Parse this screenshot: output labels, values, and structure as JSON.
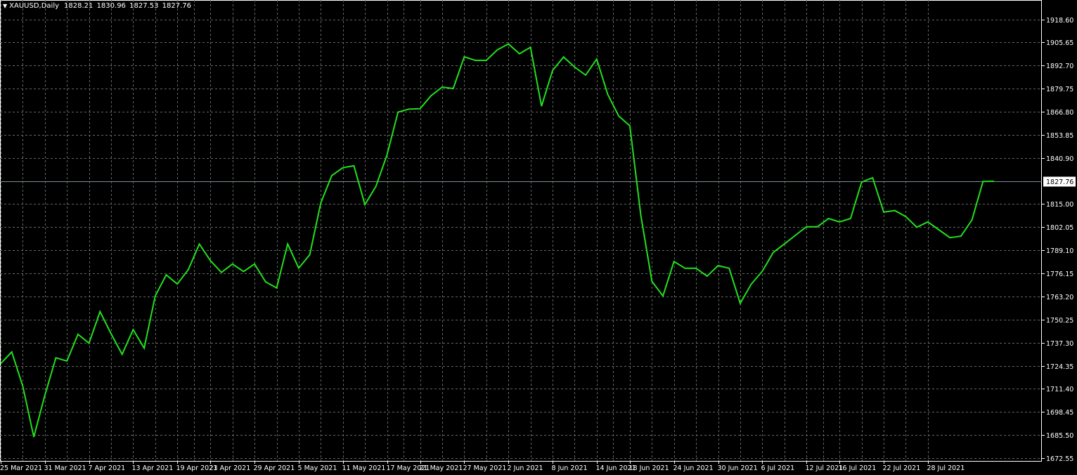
{
  "header": {
    "symbol": "XAUUSD,Daily",
    "open": "1828.21",
    "high": "1830.96",
    "low": "1827.53",
    "close": "1827.76",
    "menu_icon": "triangle-down-icon"
  },
  "colors": {
    "background": "#000000",
    "grid": "#5f6a5f",
    "line": "#22e01e",
    "axis_text": "#ffffff",
    "price_line": "#7f8c9e",
    "price_label_bg": "#ffffff",
    "price_label_text": "#000000"
  },
  "chart_data": {
    "type": "line",
    "symbol": "XAUUSD",
    "timeframe": "Daily",
    "current_price": 1827.76,
    "current_price_label": "1827.76",
    "ylim": [
      1672.55,
      1925.0
    ],
    "grid": true,
    "y_ticks": [
      "1918.60",
      "1905.65",
      "1892.70",
      "1879.75",
      "1866.80",
      "1853.85",
      "1840.90",
      "1827.76",
      "1815.00",
      "1802.05",
      "1789.10",
      "1776.15",
      "1763.20",
      "1750.25",
      "1737.30",
      "1724.35",
      "1711.40",
      "1698.45",
      "1685.50",
      "1672.55"
    ],
    "x_tick_labels": [
      "25 Mar 2021",
      "31 Mar 2021",
      "7 Apr 2021",
      "13 Apr 2021",
      "19 Apr 2021",
      "23 Apr 2021",
      "29 Apr 2021",
      "5 May 2021",
      "11 May 2021",
      "17 May 2021",
      "21 May 2021",
      "27 May 2021",
      "2 Jun 2021",
      "8 Jun 2021",
      "14 Jun 2021",
      "18 Jun 2021",
      "24 Jun 2021",
      "30 Jun 2021",
      "6 Jul 2021",
      "12 Jul 2021",
      "16 Jul 2021",
      "22 Jul 2021",
      "28 Jul 2021"
    ],
    "x_tick_index": [
      0,
      4,
      8,
      12,
      16,
      19,
      23,
      27,
      31,
      35,
      38,
      42,
      46,
      50,
      54,
      57,
      61,
      65,
      69,
      73,
      76,
      80,
      84
    ],
    "series": [
      {
        "values": [
          1725.6,
          1732.1,
          1712.9,
          1684.4,
          1707.8,
          1728.8,
          1727.0,
          1742.0,
          1737.0,
          1754.7,
          1742.3,
          1730.8,
          1744.6,
          1734.2,
          1763.5,
          1775.3,
          1770.2,
          1778.3,
          1792.6,
          1783.3,
          1776.7,
          1781.4,
          1777.2,
          1781.4,
          1771.4,
          1768.0,
          1792.6,
          1779.1,
          1786.6,
          1815.6,
          1831.0,
          1835.4,
          1836.5,
          1814.7,
          1825.0,
          1842.6,
          1866.6,
          1868.3,
          1868.5,
          1875.8,
          1880.6,
          1879.8,
          1897.6,
          1895.6,
          1895.6,
          1901.5,
          1904.8,
          1899.3,
          1902.9,
          1869.9,
          1889.9,
          1897.5,
          1891.8,
          1887.3,
          1896.3,
          1876.5,
          1864.3,
          1858.9,
          1808.6,
          1771.7,
          1763.5,
          1782.8,
          1779.0,
          1779.0,
          1774.6,
          1780.5,
          1779.0,
          1759.4,
          1770.1,
          1777.3,
          1787.9,
          1792.6,
          1797.5,
          1802.3,
          1802.3,
          1806.9,
          1805.0,
          1806.9,
          1827.3,
          1829.8,
          1810.5,
          1811.4,
          1808.0,
          1802.0,
          1805.0,
          1800.6,
          1796.2,
          1797.0,
          1806.1,
          1827.7,
          1827.8
        ]
      }
    ]
  }
}
